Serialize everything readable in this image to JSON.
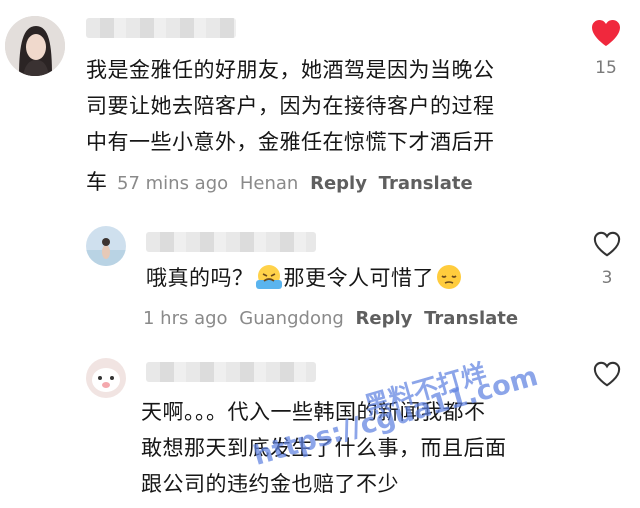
{
  "comments": [
    {
      "text_lines": [
        "我是金雅任的好朋友，她酒驾是因为当晚公",
        "司要让她去陪客户，因为在接待客户的过程",
        "中有一些小意外，金雅任在惊慌下才酒后开"
      ],
      "last_line": "车",
      "time": "57 mins ago",
      "location": "Henan",
      "reply_label": "Reply",
      "translate_label": "Translate",
      "like_count": "15",
      "liked": true
    },
    {
      "text_before": "哦真的吗？",
      "text_middle": "那更令人可惜了",
      "time": "1 hrs ago",
      "location": "Guangdong",
      "reply_label": "Reply",
      "translate_label": "Translate",
      "like_count": "3",
      "liked": false
    },
    {
      "text_lines": [
        "天啊。。。代入一些韩国的新闻我都不",
        "敢想那天到底发生了什么事，而且后面",
        "跟公司的违约金也赔了不少"
      ],
      "liked": false
    }
  ],
  "watermark": {
    "line1": "黑料不打烊",
    "line2": "https://cgua11.com"
  },
  "colors": {
    "heart_active": "#f0283d",
    "meta_text": "#8a8a8a",
    "watermark": "#5f82e1"
  }
}
